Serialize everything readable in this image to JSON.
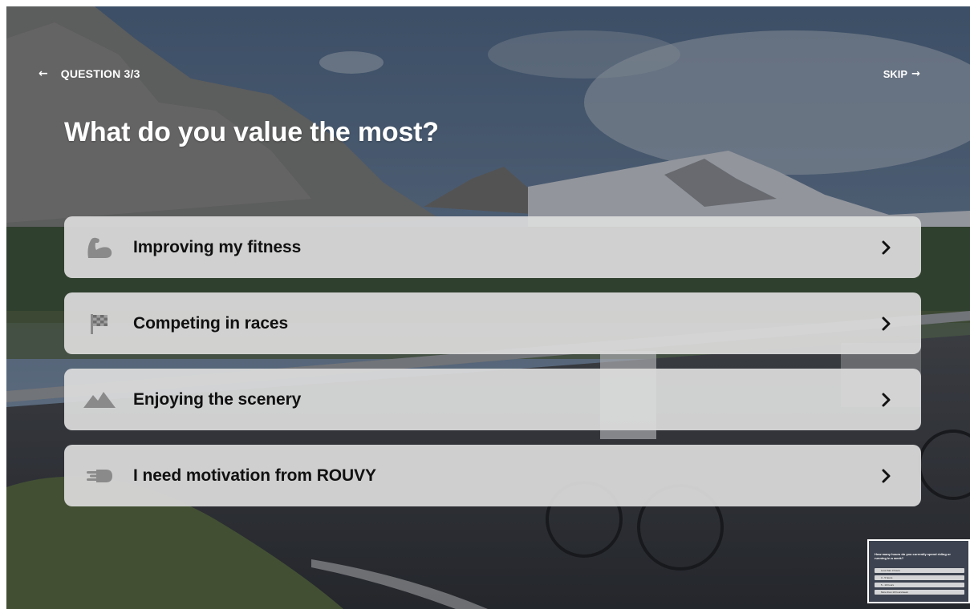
{
  "nav": {
    "back_arrow": "←",
    "question_label": "QUESTION 3/3",
    "skip_label": "SKIP",
    "skip_arrow": "→"
  },
  "title": "What do you value the most?",
  "options": [
    {
      "label": "Improving my fitness",
      "icon": "flexed-bicep-icon"
    },
    {
      "label": "Competing in races",
      "icon": "checkered-flag-icon"
    },
    {
      "label": "Enjoying the scenery",
      "icon": "mountains-icon"
    },
    {
      "label": "I need motivation from ROUVY",
      "icon": "speeding-icon"
    }
  ],
  "colors": {
    "option_bg": "#dcdcdc",
    "option_text": "#111111",
    "icon": "#8a8a8a",
    "text_light": "#ffffff"
  },
  "thumbnail": {
    "question": "How many hours do you currently spend riding or running in a week?",
    "rows": [
      "Less than 3 hours",
      "3 - 5 hours",
      "5 - 10 hours",
      "More than 10 hours/week"
    ]
  }
}
